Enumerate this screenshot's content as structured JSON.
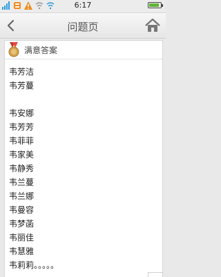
{
  "status_bar": {
    "time": "6:17",
    "icons": [
      "signal-icon",
      "message-icon",
      "warning-icon",
      "wifi-off-icon",
      "wifi-icon"
    ]
  },
  "header": {
    "title": "问题页"
  },
  "section": {
    "title": "满意答案",
    "lines": [
      "韦芳洁",
      "韦芳蔓",
      "",
      "韦安娜",
      "韦芳芳",
      "韦菲菲",
      "韦家美",
      "韦静秀",
      "韦兰蔓",
      "韦兰娜",
      "韦曼容",
      "韦梦菡",
      "韦丽佳",
      "韦慧雅",
      "韦莉莉。。。。。"
    ]
  },
  "colors": {
    "accent_orange": "#f08a1c",
    "wifi_blue": "#2a9be0",
    "battery_green": "#62b33a"
  },
  "battery_level": 0.85
}
